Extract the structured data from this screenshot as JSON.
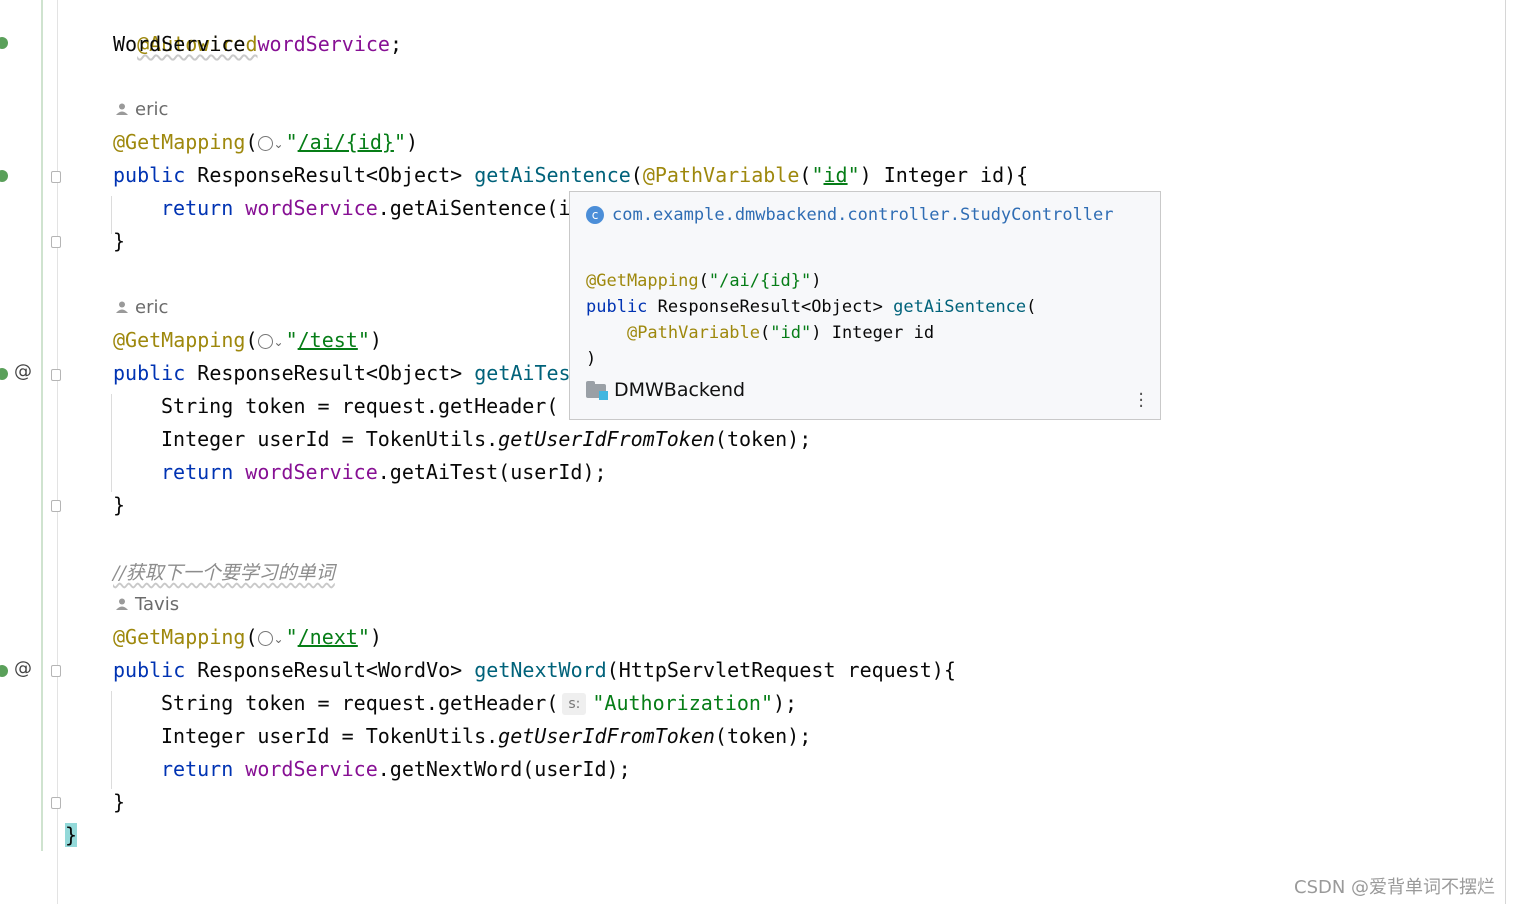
{
  "editor": {
    "lines": {
      "autowired": "@Autowired",
      "word_service_type": "WordService",
      "word_service_field": "wordService",
      "semicolon": ";",
      "public": "public",
      "return": "return",
      "get_mapping": "@GetMapping",
      "path_variable": "@PathVariable",
      "id_str": "id",
      "ai_path": "/ai/{id}",
      "test_path": "/test",
      "next_path": "/next",
      "ret_obj": "ResponseResult<Object>",
      "ret_wordvo": "ResponseResult<WordVo>",
      "m_get_ai_sentence": "getAiSentence",
      "m_get_ai_test_partial": "getAiTes",
      "m_get_next_word": "getNextWord",
      "integer_id_sig": " Integer id){",
      "line_return_ai_sentence_partial": "wordService.getAiSentence(i",
      "close_brace": "}",
      "string_token_partial": "String token = request.getHeader(",
      "string_token": "String token = request.getHeader(",
      "authorization": "Authorization",
      "header_tail": ");",
      "integer_userid": "Integer userId = TokenUtils.",
      "get_userid_from_token": "getUserIdFromToken",
      "token_tail": "(token);",
      "get_ai_test_call": ".getAiTest(userId);",
      "get_next_word_call": ".getNextWord(userId);",
      "next_word_params": "(HttpServletRequest request){",
      "comment": "//获取下一个要学习的单词",
      "hint_s": "s:"
    },
    "authors": [
      "eric",
      "eric",
      "Tavis"
    ]
  },
  "popup": {
    "class_path": "com.example.dmwbackend.controller.StudyController",
    "annotation": "@GetMapping",
    "annotation_arg": "\"/ai/{id}\"",
    "sig_public": "public",
    "sig_type": "ResponseResult<Object>",
    "sig_method": "getAiSentence",
    "param_annotation": "@PathVariable",
    "param_arg": "\"id\"",
    "param_rest": " Integer id",
    "close": ")",
    "module": "DMWBackend"
  },
  "watermark": "CSDN @爱背单词不摆烂",
  "colors": {
    "keyword": "#0033b3",
    "annotation": "#9e880d",
    "string": "#067d17",
    "field": "#871094",
    "method": "#00627a"
  }
}
